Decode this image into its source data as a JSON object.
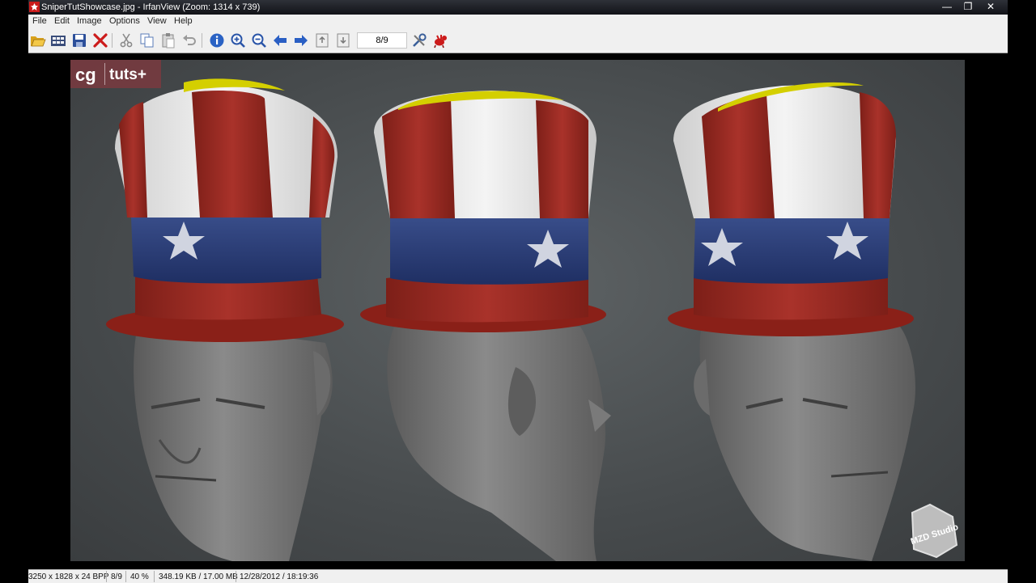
{
  "window": {
    "title": "SniperTutShowcase.jpg - IrfanView (Zoom: 1314 x 739)"
  },
  "menu": [
    "File",
    "Edit",
    "Image",
    "Options",
    "View",
    "Help"
  ],
  "toolbar": {
    "icons": [
      "open-folder-icon",
      "thumbnails-icon",
      "save-icon",
      "delete-icon",
      "cut-icon",
      "copy-icon",
      "paste-icon",
      "undo-icon",
      "info-icon",
      "zoom-in-icon",
      "zoom-out-icon",
      "previous-icon",
      "next-icon",
      "first-page-icon",
      "last-page-icon",
      "properties-icon",
      "irfanview-logo-icon"
    ],
    "page_value": "8/9"
  },
  "image": {
    "logo_left": "cg",
    "logo_right": "tuts+",
    "watermark": "MZD Studio"
  },
  "status": {
    "dimensions": "3250 x 1828 x 24 BPP",
    "page": "8/9",
    "zoom": "40 %",
    "size": "348.19 KB / 17.00 MB",
    "datetime": "12/28/2012 / 18:19:36"
  },
  "colors": {
    "titlebar": "#1c1e22",
    "hat_red": "#9e2a22",
    "hat_blue": "#2b3f78",
    "hat_white": "#e8e8e8",
    "hat_yellow": "#d6d200",
    "head_gray": "#7b7b7b",
    "backdrop": "#4a4e50"
  }
}
